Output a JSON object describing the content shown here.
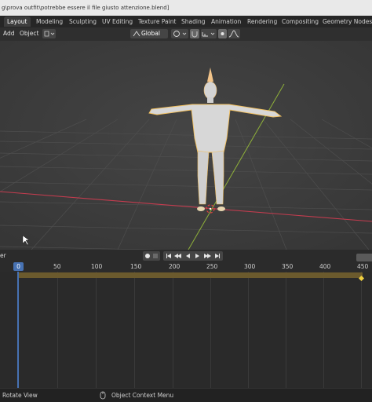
{
  "window": {
    "title": "g\\prova outfit\\potrebbe essere il file giusto attenzione.blend]"
  },
  "workspaces": [
    "Layout",
    "Modeling",
    "Sculpting",
    "UV Editing",
    "Texture Paint",
    "Shading",
    "Animation",
    "Rendering",
    "Compositing",
    "Geometry Nodes"
  ],
  "header": {
    "add": "Add",
    "object": "Object",
    "orientation": "Global"
  },
  "timeline": {
    "left_label": "er",
    "current_frame": "0",
    "ticks": [
      "50",
      "100",
      "150",
      "200",
      "250",
      "300",
      "350",
      "400",
      "450"
    ]
  },
  "status": {
    "left": "Rotate View",
    "middle": "Object Context Menu"
  },
  "colors": {
    "accent": "#4772b3",
    "x_axis": "#c43c4f",
    "y_axis": "#8fb13a",
    "keybar": "#6b5a2d"
  }
}
